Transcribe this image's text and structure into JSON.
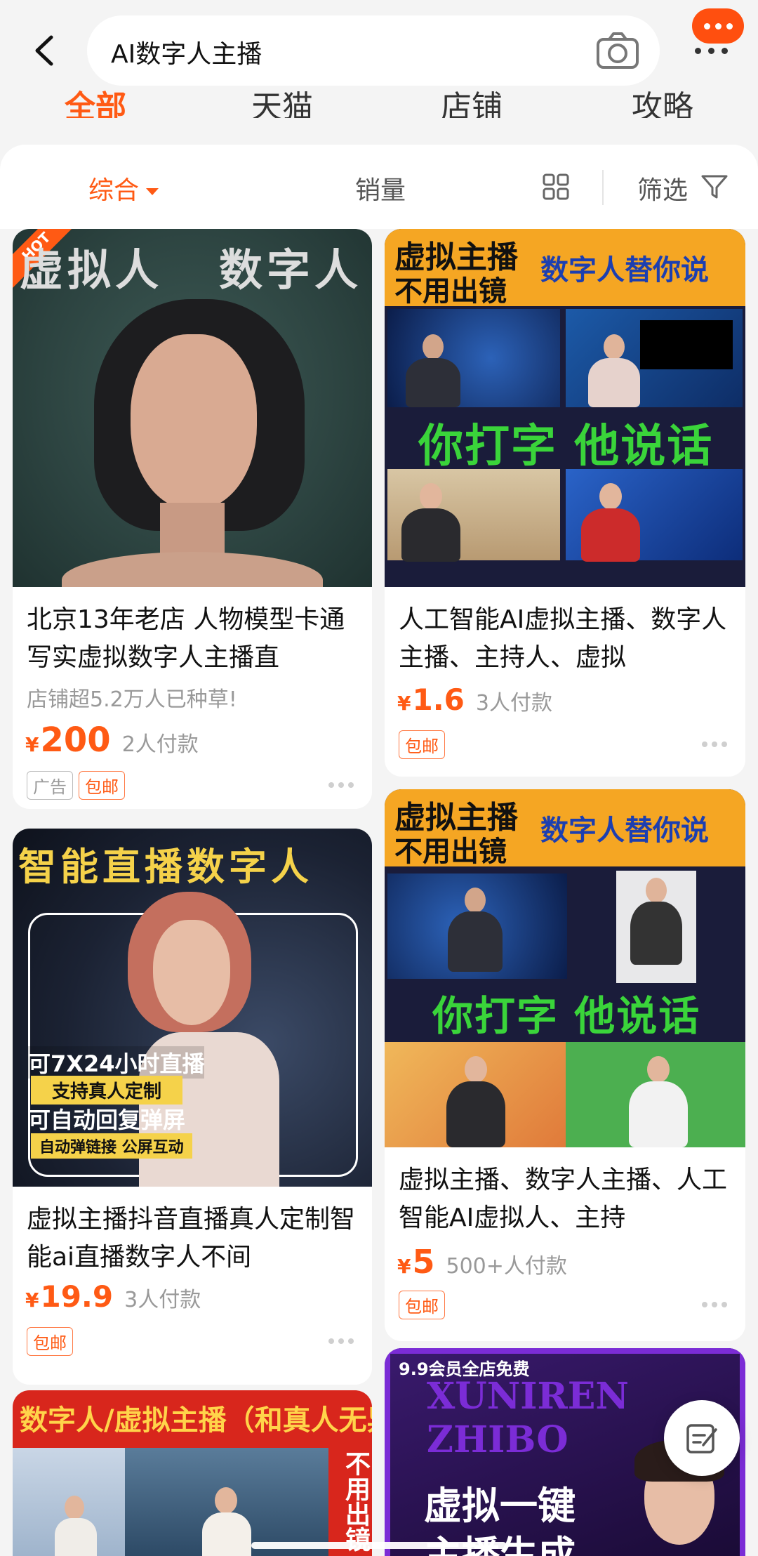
{
  "search": {
    "query": "AI数字人主播"
  },
  "tabs": [
    {
      "label": "全部",
      "active": true
    },
    {
      "label": "天猫",
      "active": false
    },
    {
      "label": "店铺",
      "active": false
    },
    {
      "label": "攻略",
      "active": false
    }
  ],
  "sort": {
    "comprehensive": "综合",
    "sales": "销量",
    "filter": "筛选"
  },
  "colors": {
    "accent": "#ff5a14",
    "brand_orange": "#ff4f0f",
    "tag_border": "#ff7a45"
  },
  "products": [
    {
      "title": "北京13年老店 人物模型卡通写实虚拟数字人主播直",
      "subline": "店铺超5.2万人已种草!",
      "currency": "¥",
      "price": "200",
      "paid": "2人付款",
      "tags": [
        "广告",
        "包邮"
      ],
      "poster": {
        "badge": "HOT",
        "left": "虚拟人",
        "right": "数字人"
      }
    },
    {
      "title": "人工智能AI虚拟主播、数字人主播、主持人、虚拟",
      "currency": "¥",
      "price": "1.6",
      "paid": "3人付款",
      "tags": [
        "包邮"
      ],
      "poster": {
        "line1": "虚拟主播",
        "line2": "不用出镜",
        "right": "数字人替你说",
        "middle": "你打字 他说话"
      }
    },
    {
      "title": "虚拟主播抖音直播真人定制智能ai直播数字人不间",
      "currency": "¥",
      "price": "19.9",
      "paid": "3人付款",
      "tags": [
        "包邮"
      ],
      "poster": {
        "top": "智能直播数字人",
        "l1": "可7X24小时直播",
        "l2": "支持真人定制",
        "l3": "可自动回复弹屏",
        "l4": "自动弹链接 公屏互动"
      }
    },
    {
      "title": "虚拟主播、数字人主播、人工智能AI虚拟人、主持",
      "currency": "¥",
      "price": "5",
      "paid": "500+人付款",
      "tags": [
        "包邮"
      ],
      "poster": {
        "line1": "虚拟主播",
        "line2": "不用出镜",
        "right": "数字人替你说",
        "middle": "你打字 他说话"
      }
    },
    {
      "poster": {
        "top": "数字人/虚拟主播（和真人无异",
        "side": "不用出镜"
      }
    },
    {
      "poster": {
        "badge": "9.9会员全店免费",
        "l1": "XUNIREN",
        "l2": "ZHIBO",
        "l3": "虚拟一键",
        "l4": "主播生成"
      }
    }
  ]
}
